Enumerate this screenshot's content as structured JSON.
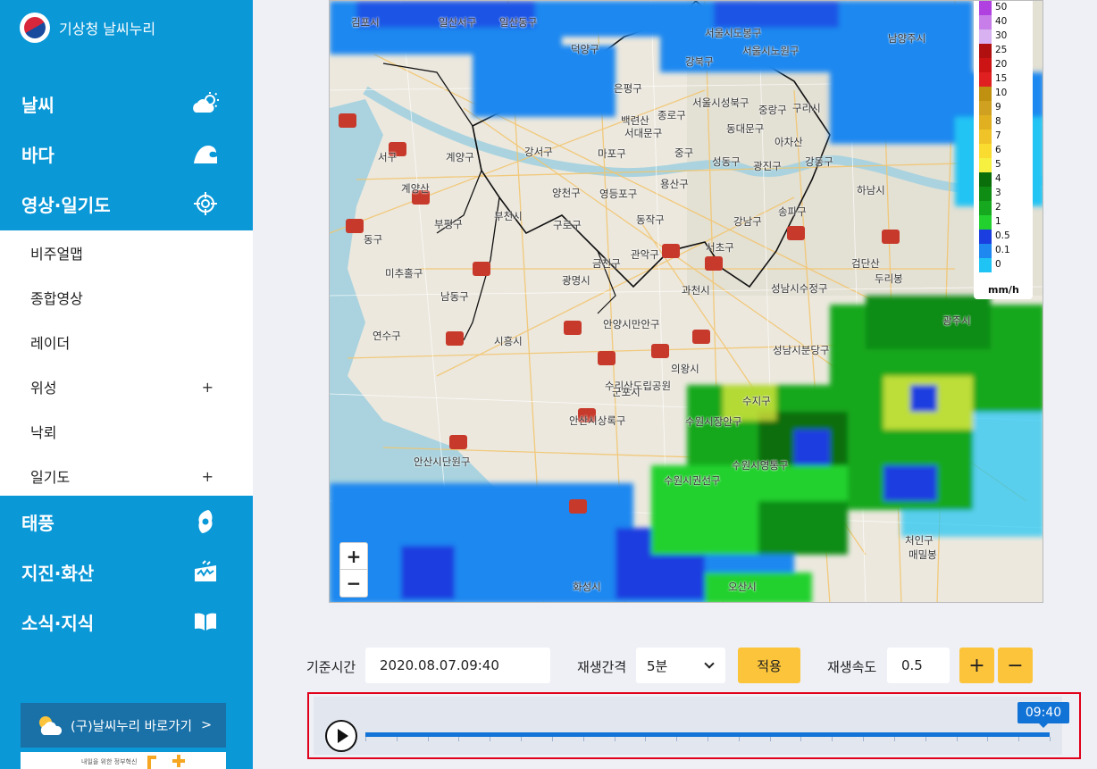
{
  "sidebar": {
    "logo_text": "기상청 날씨누리",
    "menu": [
      {
        "label": "날씨",
        "icon": "partly-cloudy-icon"
      },
      {
        "label": "바다",
        "icon": "wave-icon"
      },
      {
        "label": "영상·일기도",
        "icon": "target-icon"
      },
      {
        "label": "태풍",
        "icon": "typhoon-icon"
      },
      {
        "label": "지진·화산",
        "icon": "earthquake-icon"
      },
      {
        "label": "소식·지식",
        "icon": "book-icon"
      }
    ],
    "submenu": [
      {
        "label": "비주얼맵",
        "expandable": false
      },
      {
        "label": "종합영상",
        "expandable": false
      },
      {
        "label": "레이더",
        "expandable": false
      },
      {
        "label": "위성",
        "expandable": true
      },
      {
        "label": "낙뢰",
        "expandable": false
      },
      {
        "label": "일기도",
        "expandable": true
      }
    ],
    "expand_symbol": "+",
    "old_site_link": "(구)날씨누리 바로가기",
    "old_site_chevron": ">",
    "banner_text": "내일을 위한 정부혁신"
  },
  "map": {
    "zoom_in": "+",
    "zoom_out": "−",
    "legend": {
      "unit": "mm/h",
      "items": [
        {
          "value": "50",
          "color": "#b040e0"
        },
        {
          "value": "40",
          "color": "#c77ee8"
        },
        {
          "value": "30",
          "color": "#d8b2f0"
        },
        {
          "value": "25",
          "color": "#b01010"
        },
        {
          "value": "20",
          "color": "#cc1414"
        },
        {
          "value": "15",
          "color": "#e02020"
        },
        {
          "value": "10",
          "color": "#c09010"
        },
        {
          "value": "9",
          "color": "#d0a020"
        },
        {
          "value": "8",
          "color": "#e0b020"
        },
        {
          "value": "7",
          "color": "#f0c428"
        },
        {
          "value": "6",
          "color": "#fadc30"
        },
        {
          "value": "5",
          "color": "#f6f040"
        },
        {
          "value": "4",
          "color": "#0a6e0a"
        },
        {
          "value": "3",
          "color": "#0f8c14"
        },
        {
          "value": "2",
          "color": "#16a81e"
        },
        {
          "value": "1",
          "color": "#22d12e"
        },
        {
          "value": "0.5",
          "color": "#1a3ee0"
        },
        {
          "value": "0.1",
          "color": "#1e88f0"
        },
        {
          "value": "0",
          "color": "#20c4f4"
        }
      ]
    },
    "places": [
      "김포시",
      "일산서구",
      "일산동구",
      "덕양구",
      "서울시도봉구",
      "서울시노원구",
      "남양주시",
      "강북구",
      "은평구",
      "종로구",
      "서울시성북구",
      "중랑구",
      "구리시",
      "백련산",
      "서대문구",
      "동대문구",
      "아차산",
      "계양구",
      "강서구",
      "마포구",
      "중구",
      "성동구",
      "광진구",
      "강동구",
      "부평구",
      "양천구",
      "영등포구",
      "용산구",
      "하남시",
      "부천시",
      "구로구",
      "동작구",
      "강남구",
      "송파구",
      "미추홀구",
      "금천구",
      "관악구",
      "서초구",
      "검단산",
      "과천시",
      "광명시",
      "성남시수정구",
      "두리봉",
      "남동구",
      "연수구",
      "안양시만안구",
      "광주시",
      "시흥시",
      "의왕시",
      "성남시분당구",
      "수리산도립공원",
      "군포시",
      "수지구",
      "안산시상록구",
      "수원시장안구",
      "안산시단원구",
      "수원시영통구",
      "수원시권선구",
      "처인구",
      "매밀봉",
      "화성시",
      "오산시",
      "서구",
      "동구",
      "계양산",
      "부천시"
    ]
  },
  "controls": {
    "base_time_label": "기준시간",
    "base_time_value": "2020.08.07.09:40",
    "interval_label": "재생간격",
    "interval_value": "5분",
    "apply_label": "적용",
    "speed_label": "재생속도",
    "speed_value": "0.5",
    "speed_up": "+",
    "speed_down": "−"
  },
  "timeline": {
    "current_time": "09:40",
    "progress": 1.0
  }
}
